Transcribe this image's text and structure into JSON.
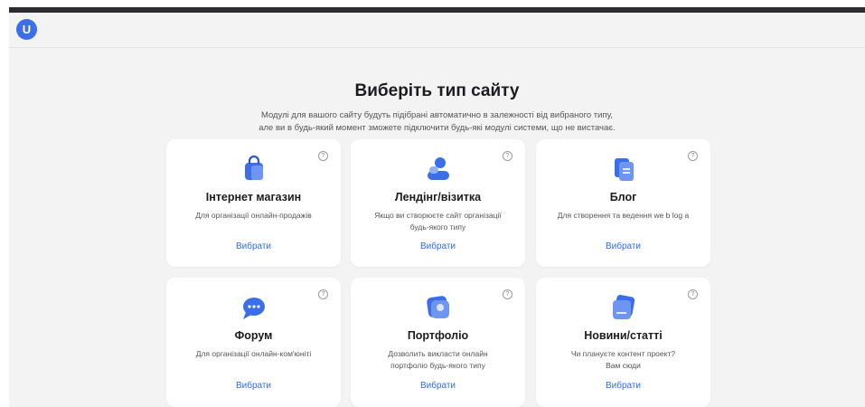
{
  "header": {
    "logo_letter": "U"
  },
  "page": {
    "title": "Виберіть тип сайту",
    "subtitle_line1": "Модулі для вашого сайту будуть підібрані автоматично в залежності від вибраного типу,",
    "subtitle_line2": "але ви в будь-який момент зможете підключити будь-які модулі системи, що не вистачає."
  },
  "colors": {
    "accent": "#2f6ee5",
    "icon_primary": "#3b6ee8",
    "icon_light": "#8fb0f5"
  },
  "help_glyph": "?",
  "cards": [
    {
      "icon": "shopping-bag-icon",
      "title": "Інтернет магазин",
      "desc_line1": "Для організації онлайн-продажів",
      "desc_line2": "",
      "action": "Вибрати"
    },
    {
      "icon": "user-card-icon",
      "title": "Лендінг/візитка",
      "desc_line1": "Якщо ви створюєте сайт організації",
      "desc_line2": "будь-якого типу",
      "action": "Вибрати"
    },
    {
      "icon": "blog-document-icon",
      "title": "Блог",
      "desc_line1": "Для створення та ведення we b log a",
      "desc_line2": "",
      "action": "Вибрати"
    },
    {
      "icon": "chat-bubble-icon",
      "title": "Форум",
      "desc_line1": "Для організації онлайн-ком'юніті",
      "desc_line2": "",
      "action": "Вибрати"
    },
    {
      "icon": "portfolio-image-icon",
      "title": "Портфоліо",
      "desc_line1": "Дозволить викласти онлайн",
      "desc_line2": "портфоліо будь-якого типу",
      "action": "Вибрати"
    },
    {
      "icon": "news-cards-icon",
      "title": "Новини/статті",
      "desc_line1": "Чи плануєте контент проект?",
      "desc_line2": "Вам сюди",
      "action": "Вибрати"
    }
  ]
}
